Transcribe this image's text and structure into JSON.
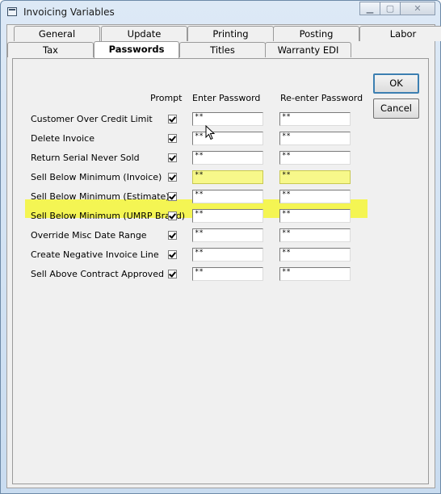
{
  "window": {
    "title": "Invoicing Variables"
  },
  "tabs_row1": [
    "General",
    "Update",
    "Printing",
    "Posting",
    "Labor"
  ],
  "tabs_row2": [
    "Tax",
    "Passwords",
    "Titles",
    "Warranty EDI"
  ],
  "headers": {
    "prompt": "Prompt",
    "enter": "Enter Password",
    "reenter": "Re-enter Password"
  },
  "rows": [
    {
      "label": "Customer Over Credit Limit",
      "prompt": true,
      "pw": "**",
      "pw2": "**"
    },
    {
      "label": "Delete Invoice",
      "prompt": true,
      "pw": "**",
      "pw2": "**"
    },
    {
      "label": "Return Serial Never Sold",
      "prompt": true,
      "pw": "**",
      "pw2": "**"
    },
    {
      "label": "Sell Below Minimum (Invoice)",
      "prompt": true,
      "pw": "**",
      "pw2": "**"
    },
    {
      "label": "Sell Below Minimum (Estimate)",
      "prompt": true,
      "pw": "**",
      "pw2": "**"
    },
    {
      "label": "Sell Below Minimum (UMRP Brand)",
      "prompt": true,
      "pw": "**",
      "pw2": "**"
    },
    {
      "label": "Override Misc Date Range",
      "prompt": true,
      "pw": "**",
      "pw2": "**"
    },
    {
      "label": "Create Negative Invoice Line",
      "prompt": true,
      "pw": "**",
      "pw2": "**"
    },
    {
      "label": "Sell Above Contract Approved",
      "prompt": true,
      "pw": "**",
      "pw2": "**"
    }
  ],
  "buttons": {
    "ok": "OK",
    "cancel": "Cancel"
  },
  "colors": {
    "highlight": "#f4f553"
  }
}
